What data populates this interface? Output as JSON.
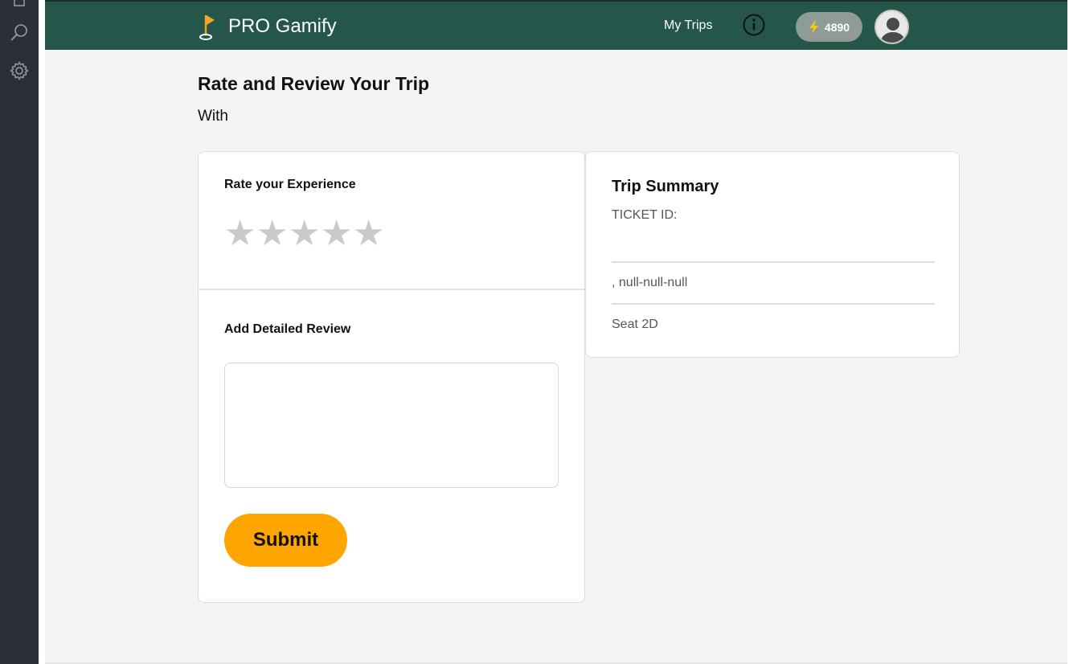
{
  "app": {
    "brand_name": "PRO Gamify"
  },
  "nav": {
    "my_trips_label": "My Trips",
    "points": "4890"
  },
  "page": {
    "title": "Rate and Review Your Trip",
    "subtitle": "With"
  },
  "rating": {
    "label": "Rate your Experience",
    "max_stars": 5,
    "selected": 0
  },
  "review": {
    "label": "Add Detailed Review",
    "value": "",
    "placeholder": ""
  },
  "submit_label": "Submit",
  "summary": {
    "title": "Trip Summary",
    "ticket_label": "TICKET ID:",
    "route_text": ", null-null-null",
    "seat_text": "Seat 2D"
  },
  "colors": {
    "header_bg": "#25564a",
    "accent": "#ffa500",
    "star_inactive": "#cacaca",
    "page_bg": "#f5f3f4"
  },
  "icons": {
    "sidebar": [
      "search-icon",
      "gear-icon"
    ],
    "header": [
      "flag-logo-icon",
      "info-icon",
      "lightning-icon",
      "user-avatar-icon"
    ],
    "rating": "star-icon"
  }
}
